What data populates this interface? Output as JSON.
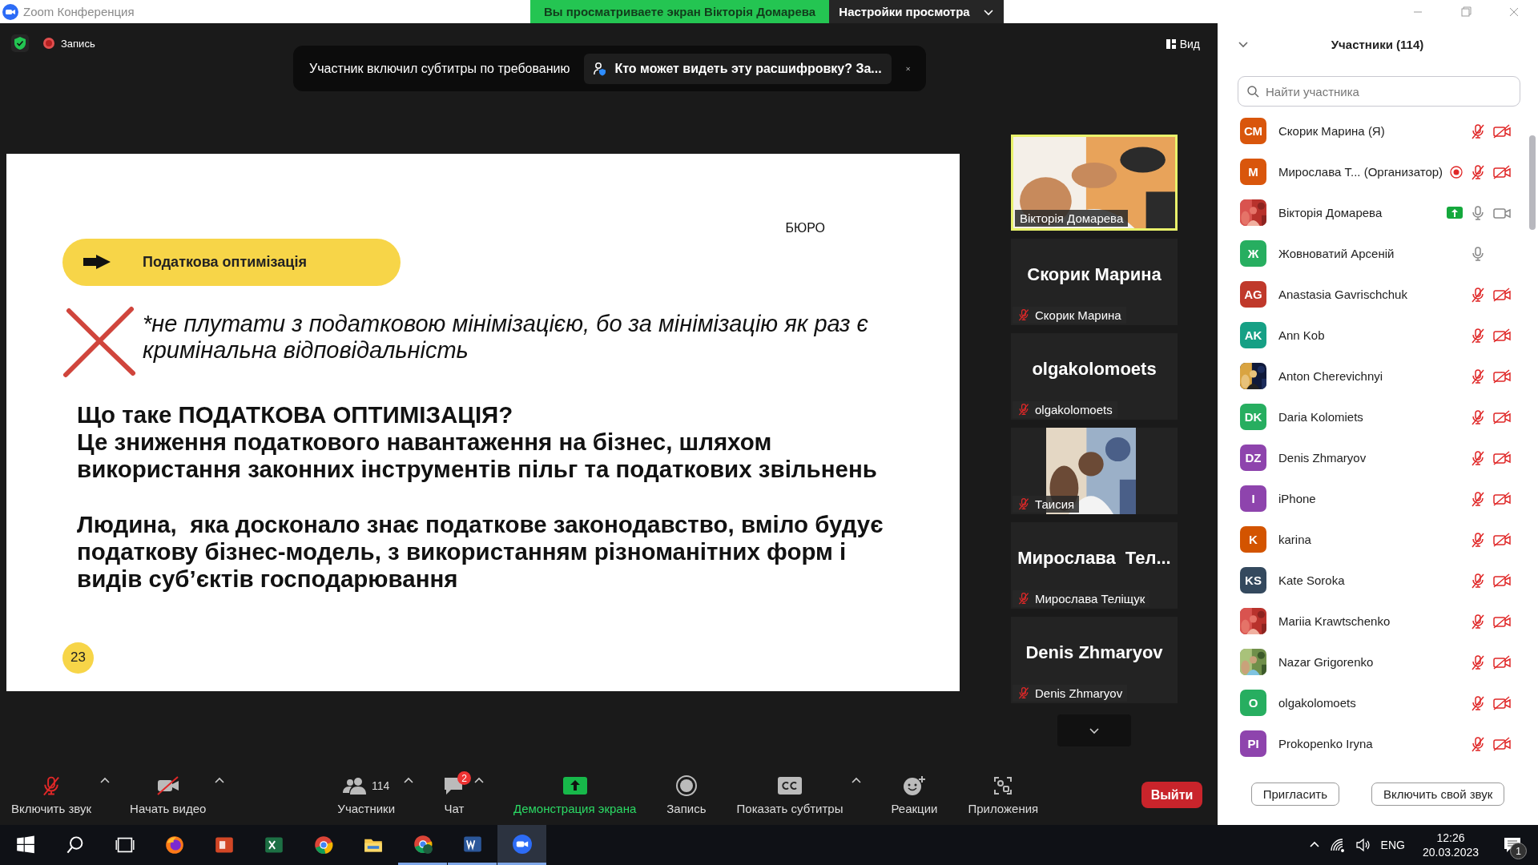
{
  "window": {
    "title": "Zoom Конференция"
  },
  "share_banner": {
    "text": "Вы просматриваете экран Вікторія Домарева",
    "settings": "Настройки просмотра"
  },
  "meeting_bar": {
    "record_label": "Запись",
    "view_label": "Вид"
  },
  "toast": {
    "message": "Участник включил субтитры по требованию",
    "link": "Кто может видеть эту расшифровку? За..."
  },
  "slide": {
    "pill": "Податкова оптимізація",
    "brand": "БЮРО",
    "note": "*не плутати з податковою мінімізацією, бо за мінімізацію як раз є кримінальна відповідальність",
    "heading": "Що таке ПОДАТКОВА ОПТИМІЗАЦІЯ?",
    "paragraphs": [
      "Це зниження податкового навантаження на бізнес, шляхом використання законних інструментів пільг та податкових звільнень",
      "Людина,  яка досконало знає податкове законодавство, вміло будує податкову бізнес-модель, з використанням різноманітних форм і видів суб’єктів господарювання"
    ],
    "page": "23"
  },
  "video_tiles": [
    {
      "kind": "video",
      "label": "Вікторія Домарева",
      "speaking": true,
      "muted": false
    },
    {
      "kind": "name",
      "display": "Скорик Марина",
      "label": "Скорик Марина",
      "speaking": false,
      "muted": true
    },
    {
      "kind": "name",
      "display": "olgakolomoets",
      "label": "olgakolomoets",
      "speaking": false,
      "muted": true
    },
    {
      "label": "Таисия",
      "speaking": false,
      "muted": true
    },
    {
      "kind": "name",
      "display": "Мирослава  Тел...",
      "label": "Мирослава Теліщук",
      "speaking": false,
      "muted": true
    },
    {
      "kind": "name",
      "display": "Denis Zhmaryov",
      "label": "Denis Zhmaryov",
      "speaking": false,
      "muted": true
    }
  ],
  "toolbar": {
    "items": [
      {
        "kind": "mic",
        "label": "Включить звук",
        "crossed": true,
        "caret": true
      },
      {
        "kind": "video",
        "label": "Начать видео",
        "crossed": true,
        "caret": true
      },
      {
        "kind": "participants",
        "label": "Участники",
        "count": "114",
        "caret": true
      },
      {
        "kind": "chat",
        "label": "Чат",
        "badge": "2",
        "caret": true
      },
      {
        "kind": "share",
        "label": "Демонстрация экрана",
        "caret": false
      },
      {
        "kind": "record",
        "label": "Запись",
        "caret": false
      },
      {
        "kind": "captions",
        "label": "Показать субтитры",
        "caret": true
      },
      {
        "kind": "reactions",
        "label": "Реакции",
        "caret": false
      },
      {
        "kind": "apps",
        "label": "Приложения",
        "caret": false
      }
    ],
    "leave": "Выйти"
  },
  "panel": {
    "title": "Участники (114)",
    "search": {
      "placeholder": "Найти участника"
    },
    "participants": [
      {
        "name": "Скорик Марина (Я)",
        "avatar": {
          "kind": "initials",
          "text": "СМ",
          "color": "#d9560c"
        },
        "muted": true,
        "camera_shown": true,
        "video_on": false,
        "sharing": false,
        "recording": false
      },
      {
        "name": "Мирослава Т... (Организатор)",
        "avatar": {
          "kind": "initials",
          "text": "М",
          "color": "#d9560c"
        },
        "muted": true,
        "camera_shown": true,
        "video_on": false,
        "sharing": false,
        "recording": true
      },
      {
        "name": "Вікторія Домарева",
        "muted": false,
        "camera_shown": true,
        "video_on": true,
        "sharing": true,
        "recording": false
      },
      {
        "name": "Жовноватий Арсеній",
        "avatar": {
          "kind": "initials",
          "text": "Ж",
          "color": "#27ae60"
        },
        "muted": false,
        "camera_shown": false,
        "sharing": false,
        "recording": false
      },
      {
        "name": "Anastasia Gavrischchuk",
        "avatar": {
          "kind": "initials",
          "text": "AG",
          "color": "#c0392b"
        },
        "muted": true,
        "camera_shown": true,
        "video_on": false,
        "sharing": false,
        "recording": false
      },
      {
        "name": "Ann Kob",
        "avatar": {
          "kind": "initials",
          "text": "AK",
          "color": "#16a085"
        },
        "muted": true,
        "camera_shown": true,
        "video_on": false,
        "sharing": false,
        "recording": false
      },
      {
        "name": "Anton Cherevichnyi",
        "muted": true,
        "camera_shown": true,
        "video_on": false,
        "sharing": false,
        "recording": false
      },
      {
        "name": "Daria Kolomiets",
        "avatar": {
          "kind": "initials",
          "text": "DK",
          "color": "#27ae60"
        },
        "muted": true,
        "camera_shown": true,
        "video_on": false,
        "sharing": false,
        "recording": false
      },
      {
        "name": "Denis Zhmaryov",
        "avatar": {
          "kind": "initials",
          "text": "DZ",
          "color": "#8e44ad"
        },
        "muted": true,
        "camera_shown": true,
        "video_on": false,
        "sharing": false,
        "recording": false
      },
      {
        "name": "iPhone",
        "avatar": {
          "kind": "initials",
          "text": "I",
          "color": "#8e44ad"
        },
        "muted": true,
        "camera_shown": true,
        "video_on": false,
        "sharing": false,
        "recording": false
      },
      {
        "name": "karina",
        "avatar": {
          "kind": "initials",
          "text": "K",
          "color": "#d35400"
        },
        "muted": true,
        "camera_shown": true,
        "video_on": false,
        "sharing": false,
        "recording": false
      },
      {
        "name": "Kate Soroka",
        "avatar": {
          "kind": "initials",
          "text": "KS",
          "color": "#34495e"
        },
        "muted": true,
        "camera_shown": true,
        "video_on": false,
        "sharing": false,
        "recording": false
      },
      {
        "name": "Mariia Krawtschenko",
        "muted": true,
        "camera_shown": true,
        "video_on": false,
        "sharing": false,
        "recording": false
      },
      {
        "name": "Nazar Grigorenko",
        "muted": true,
        "camera_shown": true,
        "video_on": false,
        "sharing": false,
        "recording": false
      },
      {
        "name": "olgakolomoets",
        "avatar": {
          "kind": "initials",
          "text": "O",
          "color": "#27ae60"
        },
        "muted": true,
        "camera_shown": true,
        "video_on": false,
        "sharing": false,
        "recording": false
      },
      {
        "name": "Prokopenko Iryna",
        "avatar": {
          "kind": "initials",
          "text": "PI",
          "color": "#8e44ad"
        },
        "muted": true,
        "camera_shown": true,
        "video_on": false,
        "sharing": false,
        "recording": false
      }
    ],
    "buttons": [
      "Пригласить",
      "Включить свой звук"
    ]
  },
  "taskbar": {
    "apps": [
      {
        "kind": "start",
        "running": false,
        "active": false
      },
      {
        "kind": "search",
        "running": false,
        "active": false
      },
      {
        "kind": "taskview",
        "running": false,
        "active": false
      },
      {
        "kind": "firefox",
        "running": false,
        "active": false
      },
      {
        "kind": "powerpoint",
        "running": false,
        "active": false
      },
      {
        "kind": "excel",
        "running": false,
        "active": false
      },
      {
        "kind": "chrome",
        "running": false,
        "active": false
      },
      {
        "kind": "explorer",
        "running": false,
        "active": false
      },
      {
        "kind": "chrome_profile",
        "running": true,
        "active": false
      },
      {
        "kind": "word",
        "running": true,
        "active": false
      },
      {
        "kind": "zoom",
        "running": true,
        "active": true
      }
    ],
    "lang": "ENG",
    "time": "12:26",
    "date": "20.03.2023",
    "notifications": "1"
  }
}
